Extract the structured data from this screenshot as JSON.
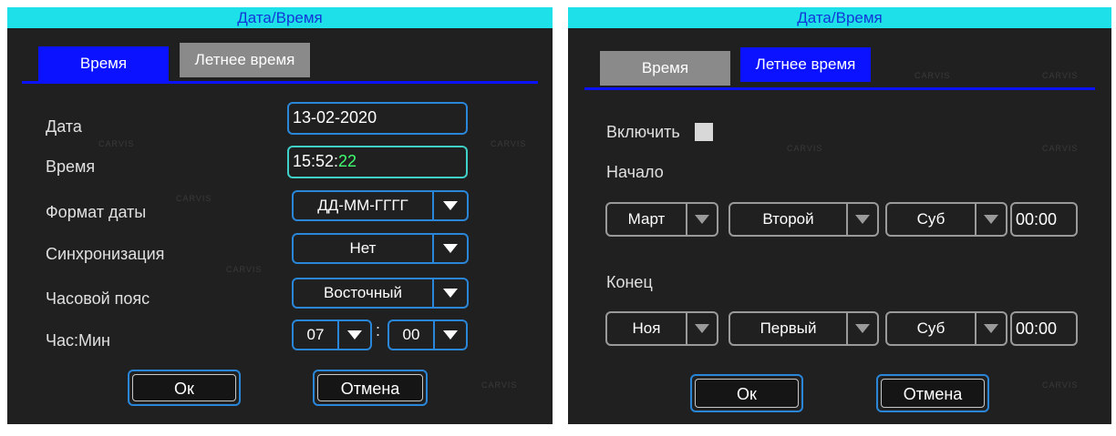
{
  "left": {
    "title": "Дата/Время",
    "tabs": [
      "Время",
      "Летнее время"
    ],
    "date": {
      "label": "Дата",
      "value": "13-02-2020"
    },
    "time": {
      "label": "Время",
      "hm": "15:52:",
      "sec": "22"
    },
    "date_format": {
      "label": "Формат даты",
      "value": "ДД-ММ-ГГГГ"
    },
    "sync": {
      "label": "Синхронизация",
      "value": "Нет"
    },
    "timezone": {
      "label": "Часовой пояс",
      "value": "Восточный"
    },
    "hourmin": {
      "label": "Час:Мин",
      "hour": "07",
      "minute": "00",
      "colon": ":"
    },
    "ok_label": "Ок",
    "cancel_label": "Отмена"
  },
  "right": {
    "title": "Дата/Время",
    "tabs": [
      "Время",
      "Летнее время"
    ],
    "enable_label": "Включить",
    "start": {
      "label": "Начало",
      "month": "Март",
      "week": "Второй",
      "day": "Суб",
      "time": "00:00"
    },
    "end": {
      "label": "Конец",
      "month": "Ноя",
      "week": "Первый",
      "day": "Суб",
      "time": "00:00"
    },
    "ok_label": "Ок",
    "cancel_label": "Отмена"
  },
  "watermark": "CARVIS",
  "icons": {
    "dropdown": "chevron-down-icon"
  },
  "colors": {
    "titlebar": "#1ee0e8",
    "title_text": "#1238d8",
    "tab_active": "#0a12ff",
    "border": "#2a86d8",
    "seconds": "#40ff70"
  }
}
